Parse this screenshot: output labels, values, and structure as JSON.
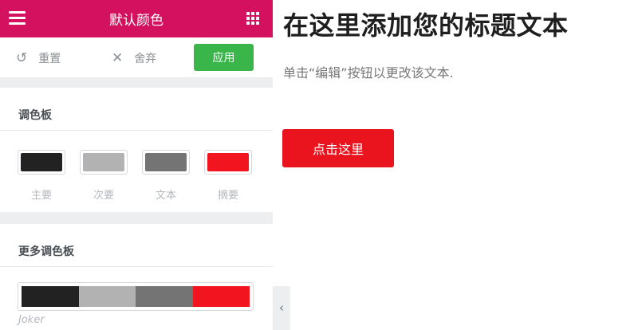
{
  "header": {
    "title": "默认颜色",
    "menu_icon": "hamburger-menu-icon",
    "grid_icon": "apps-grid-icon",
    "bg_color": "#d3115e"
  },
  "toolbar": {
    "reset_label": "重置",
    "reset_icon": "undo-icon",
    "discard_label": "舍弃",
    "discard_icon": "close-icon",
    "apply_label": "应用",
    "apply_color": "#39b54a"
  },
  "palette_section": {
    "title": "调色板",
    "swatches": [
      {
        "label": "主要",
        "color": "#222222"
      },
      {
        "label": "次要",
        "color": "#b2b2b2"
      },
      {
        "label": "文本",
        "color": "#747474"
      },
      {
        "label": "摘要",
        "color": "#f2141e"
      }
    ]
  },
  "more_palettes": {
    "title": "更多调色板",
    "palettes": [
      {
        "name": "Joker",
        "colors": [
          "#222222",
          "#b2b2b2",
          "#747474",
          "#f2141e"
        ]
      }
    ]
  },
  "collapse_icon": "chevron-left-icon",
  "content": {
    "heading": "在这里添加您的标题文本",
    "paragraph": "单击“编辑”按钮以更改该文本.",
    "button_label": "点击这里",
    "button_color": "#e9141e"
  }
}
